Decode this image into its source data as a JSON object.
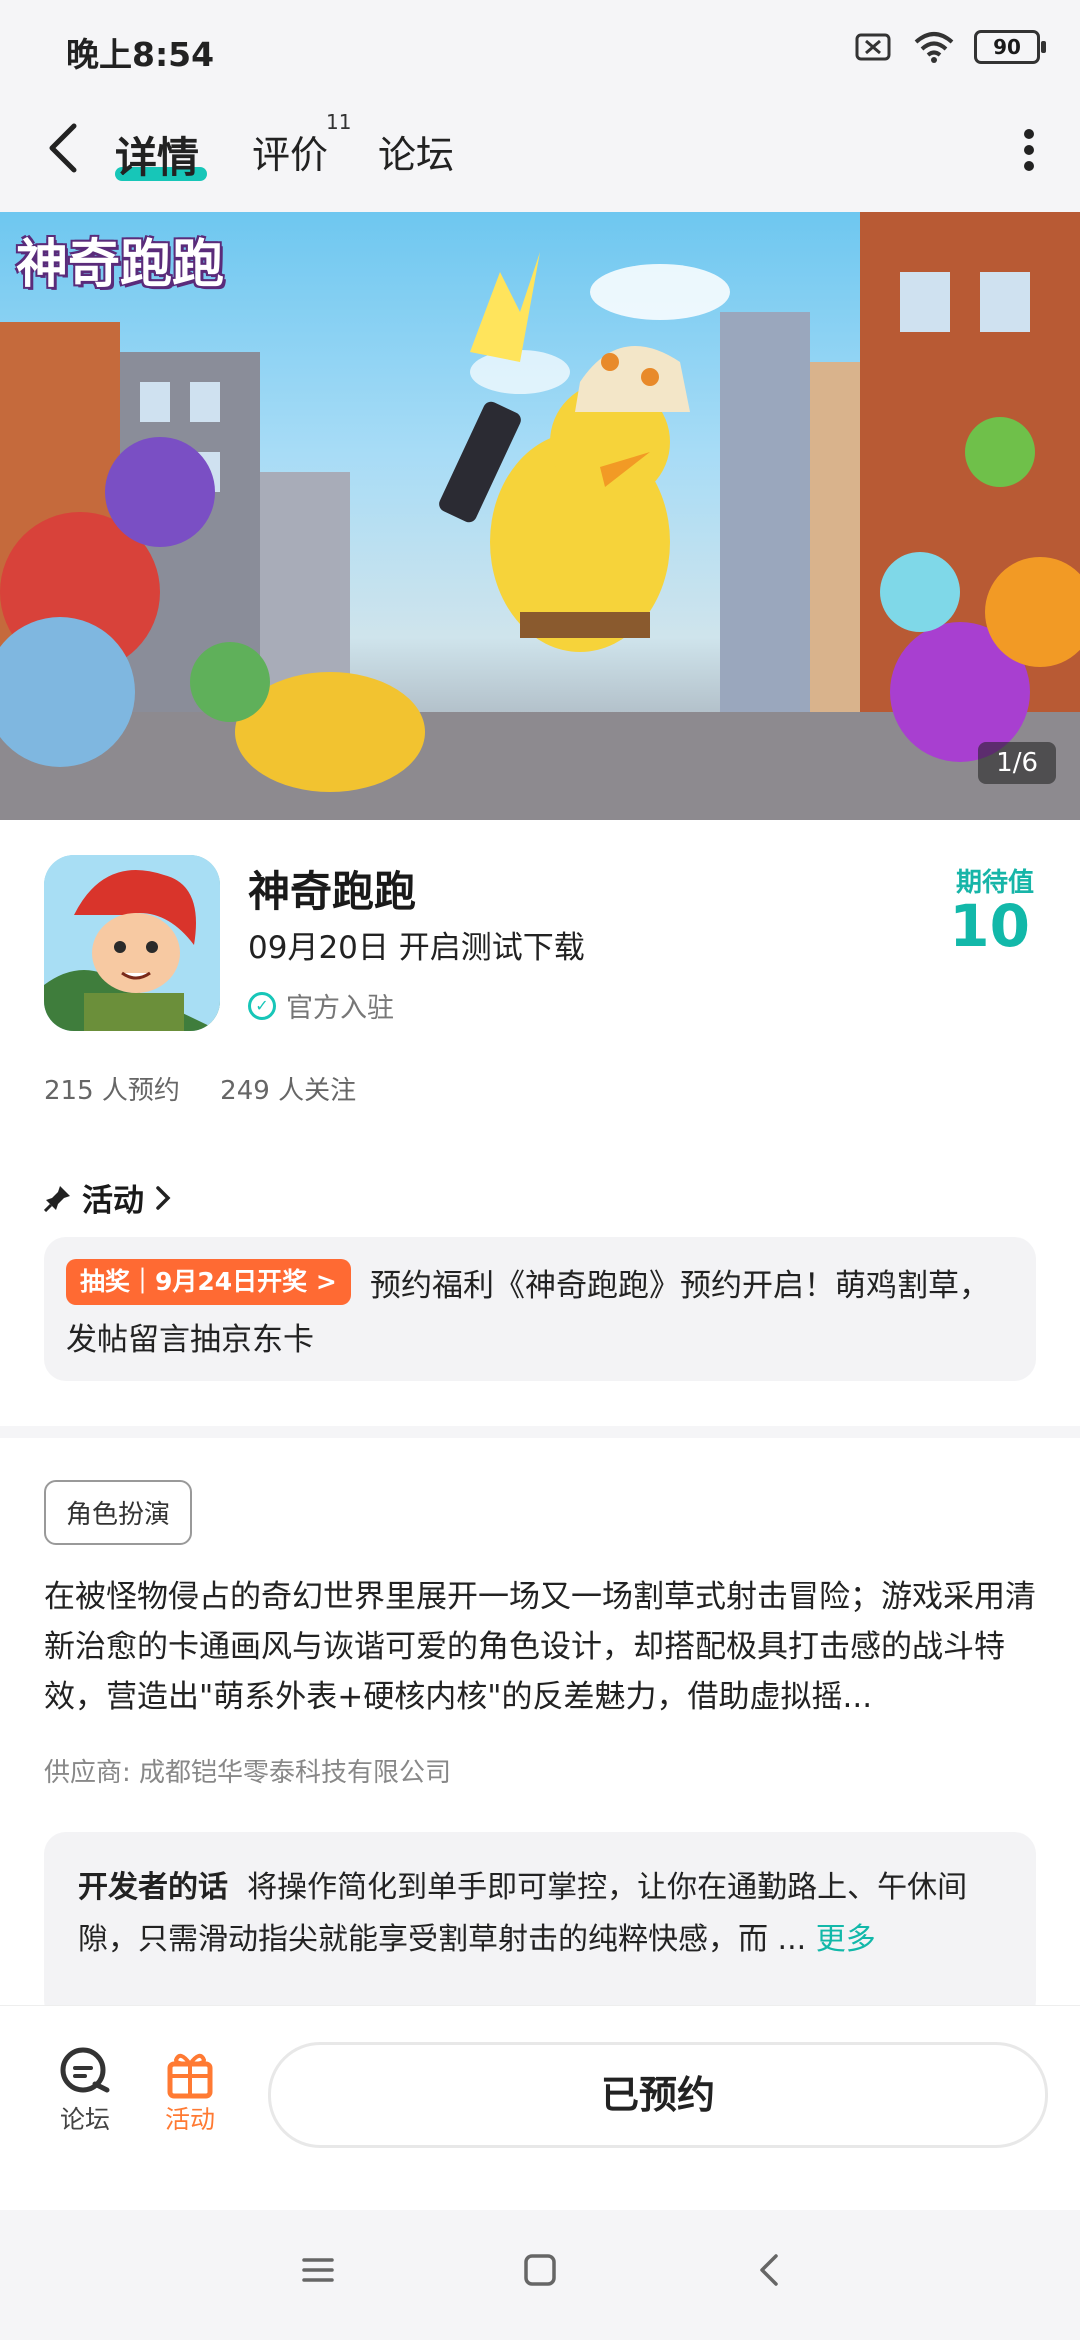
{
  "status_bar": {
    "time": "晚上8:54",
    "battery": "90"
  },
  "nav": {
    "tabs": [
      {
        "label": "详情",
        "active": true
      },
      {
        "label": "评价",
        "badge": "11"
      },
      {
        "label": "论坛"
      }
    ]
  },
  "banner": {
    "title": "神奇跑跑",
    "page_indicator": "1/6"
  },
  "app": {
    "name": "神奇跑跑",
    "release": "09月20日 开启测试下载",
    "official": "官方入驻",
    "expect_label": "期待值",
    "expect_value": "10",
    "reservations": "215 人预约",
    "followers": "249 人关注"
  },
  "activity": {
    "title": "活动",
    "tag": "抽奖｜9月24日开奖 >",
    "text": "预约福利《神奇跑跑》预约开启！萌鸡割草，发帖留言抽京东卡"
  },
  "details": {
    "category": "角色扮演",
    "description": "在被怪物侵占的奇幻世界里展开一场又一场割草式射击冒险；游戏采用清新治愈的卡通画风与诙谐可爱的角色设计，却搭配极具打击感的战斗特效，营造出\"萌系外表+硬核内核\"的反差魅力，借助虚拟摇...",
    "supplier": "供应商: 成都铠华零泰科技有限公司",
    "dev_label": "开发者的话",
    "dev_text": "将操作简化到单手即可掌控，让你在通勤路上、午休间隙，只需滑动指尖就能享受割草射击的纯粹快感，而 ...",
    "more": "更多"
  },
  "bottom_bar": {
    "forum": "论坛",
    "activity": "活动",
    "reserve_button": "已预约"
  },
  "colors": {
    "accent": "#12b8a9",
    "lottery": "#ff6a33",
    "activity_tab": "#ff7a33"
  }
}
